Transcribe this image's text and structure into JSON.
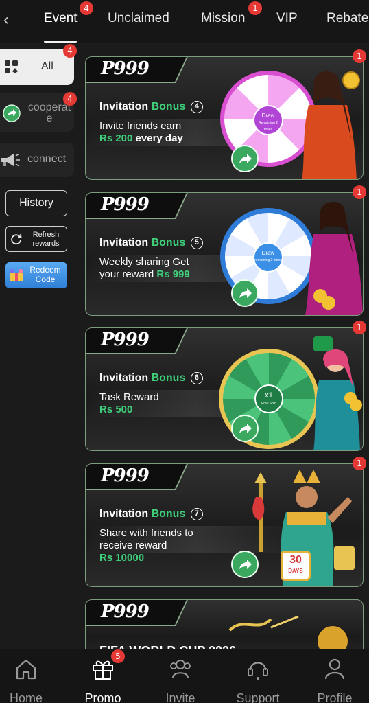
{
  "header": {
    "tabs": [
      {
        "label": "Event",
        "badge": "4"
      },
      {
        "label": "Unclaimed"
      },
      {
        "label": "Mission",
        "badge": "1"
      },
      {
        "label": "VIP"
      },
      {
        "label": "Rebate"
      }
    ]
  },
  "sidebar": {
    "categories": [
      {
        "label": "All",
        "badge": "4",
        "icon": "grid-icon"
      },
      {
        "label": "cooperate",
        "badge": "4",
        "icon": "share-icon"
      },
      {
        "label": "connect",
        "icon": "megaphone-icon"
      }
    ],
    "history_label": "History",
    "refresh_label_1": "Refresh",
    "refresh_label_2": "rewards",
    "redeem_label_1": "Redeem",
    "redeem_label_2": "Code"
  },
  "promos": [
    {
      "logo": "P999",
      "title_white": "Invitation",
      "title_green": "Bonus",
      "number": "4",
      "line1": "Invite friends earn",
      "amount": "Rs 200",
      "line2": "every day",
      "badge": "1"
    },
    {
      "logo": "P999",
      "title_white": "Invitation",
      "title_green": "Bonus",
      "number": "5",
      "line1": "Weekly sharing Get",
      "line2": "your reward",
      "amount": "Rs 999",
      "badge": "1"
    },
    {
      "logo": "P999",
      "title_white": "Invitation",
      "title_green": "Bonus",
      "number": "6",
      "line1": "Task Reward",
      "amount": "Rs 500",
      "badge": "1"
    },
    {
      "logo": "P999",
      "title_white": "Invitation",
      "title_green": "Bonus",
      "number": "7",
      "line1": "Share with friends to",
      "line2": "receive reward",
      "amount": "Rs 10000",
      "badge": "1"
    },
    {
      "logo": "P999",
      "partial_text": "FIFA WORLD CUP 2026"
    }
  ],
  "wheels": {
    "w1_center": "Draw",
    "w1_sub": "Remaining 2 times",
    "w2_center": "Draw",
    "w2_sub": "remaining 2 times",
    "w3_center": "x1",
    "w3_sub": "Free Spin"
  },
  "day_badge": {
    "num": "30",
    "unit": "DAYS"
  },
  "bottom_nav": [
    {
      "label": "Home",
      "icon": "home-icon"
    },
    {
      "label": "Promo",
      "icon": "gift-icon",
      "badge": "5",
      "active": true
    },
    {
      "label": "Invite",
      "icon": "invite-icon"
    },
    {
      "label": "Support",
      "icon": "headset-icon"
    },
    {
      "label": "Profile",
      "icon": "profile-icon"
    }
  ],
  "colors": {
    "accent_green": "#3fcf7a",
    "badge_red": "#e53935",
    "card_border": "#7c9e7c"
  }
}
